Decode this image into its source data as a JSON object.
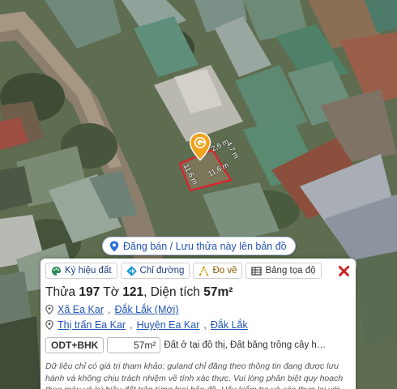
{
  "map": {
    "parcel_side_top": "2,6 m",
    "parcel_side_right": "4,7 m",
    "parcel_side_bottom": "11,6 m",
    "parcel_side_left": "11,6 m",
    "marker_icon": "guland-marker-icon"
  },
  "post_listing": {
    "label": "Đăng bán / Lưu thửa này lên bản đồ",
    "icon": "map-pin-icon"
  },
  "toolbar": {
    "symbol_label": "Ký hiệu đất",
    "directions_label": "Chỉ đường",
    "draw_label": "Đo vẽ",
    "coords_label": "Bảng tọa độ"
  },
  "parcel": {
    "plot_prefix": "Thửa ",
    "plot_number": "197",
    "sheet_prefix": " Tờ ",
    "sheet_number": "121",
    "area_prefix": ", Diện tích ",
    "area_value": "57m²"
  },
  "address_new": {
    "commune": "Xã Ea Kar",
    "separator": ", ",
    "province": "Đắk Lắk (Mới)"
  },
  "address_old": {
    "town": "Thị trấn Ea Kar",
    "district": "Huyện Ea Kar",
    "province": "Đắk Lắk",
    "separator": ", "
  },
  "land_use": {
    "code": "ODT+BHK",
    "area": "57m²",
    "description": "Đất ở tại đô thị, Đất bằng trồng cây hàng năm ..."
  },
  "disclaimer": "Dữ liệu chỉ có giá trị tham khảo: guland chỉ đăng theo thông tin đang được lưu hành và không chịu trách nhiệm về tính xác thực. Vui lòng phân biệt quy hoạch theo màu và ký hiệu đất trên từng loại bản đồ. Hãy kiểm tra và xác thực lại với cơ",
  "colors": {
    "accent_blue": "#2254b4",
    "marker_orange": "#f0a21a",
    "parcel_outline": "#e0202a",
    "close_red": "#c62a2a"
  }
}
